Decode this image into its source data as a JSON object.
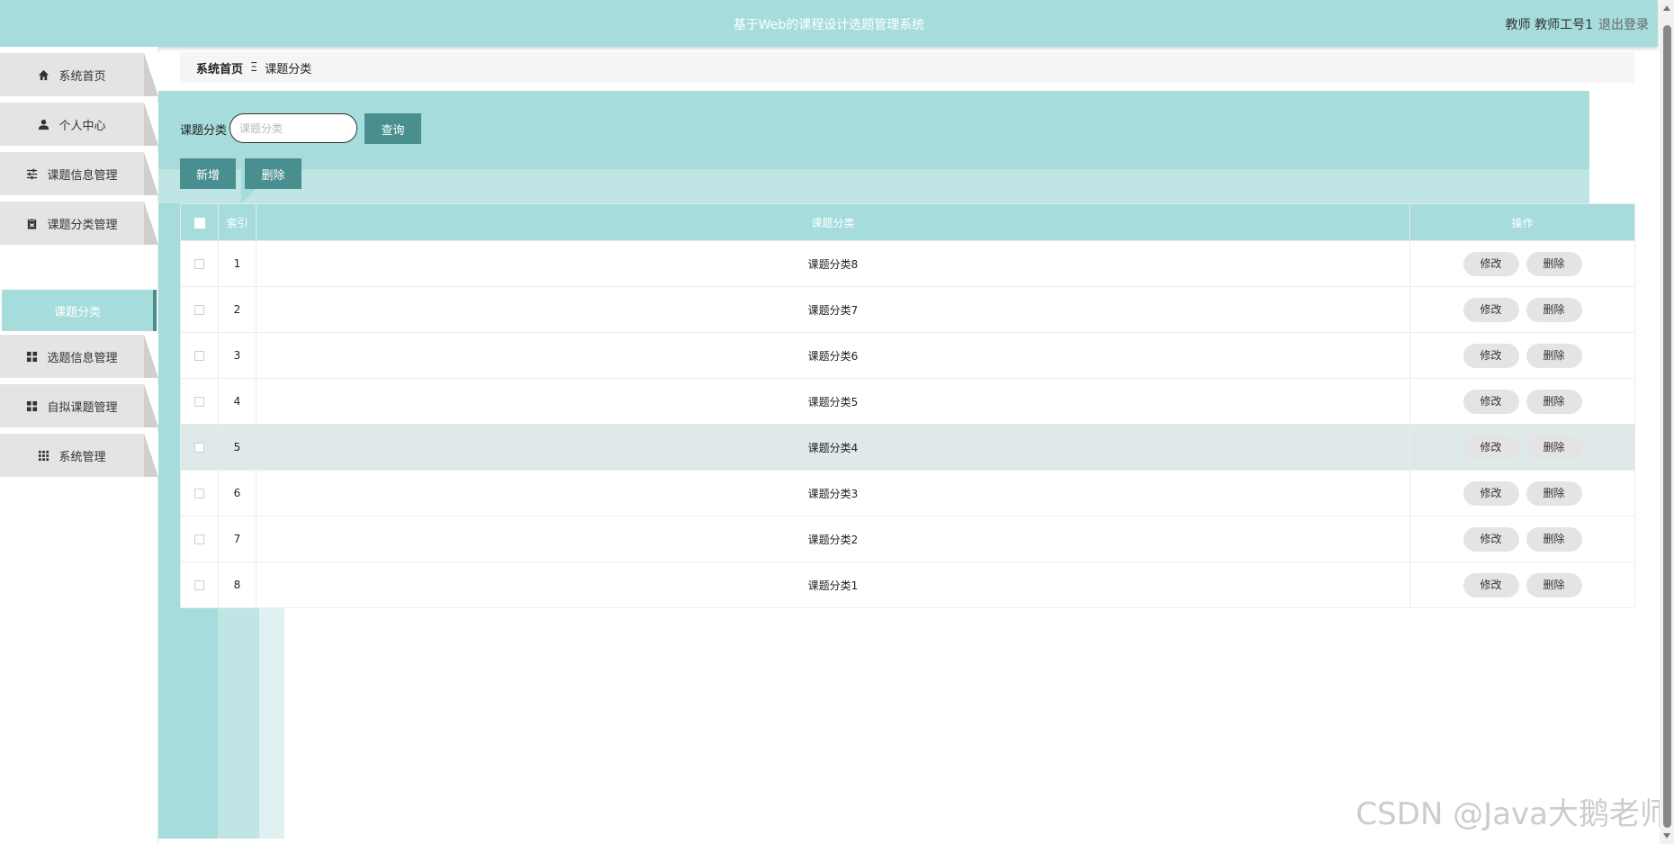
{
  "header": {
    "title": "基于Web的课程设计选题管理系统",
    "user": "教师 教师工号1",
    "logout": "退出登录"
  },
  "sidebar": {
    "items": [
      {
        "label": "系统首页",
        "icon": "home-icon"
      },
      {
        "label": "个人中心",
        "icon": "user-icon"
      },
      {
        "label": "课题信息管理",
        "icon": "sliders-icon"
      },
      {
        "label": "课题分类管理",
        "icon": "clipboard-icon"
      },
      {
        "label": "选题信息管理",
        "icon": "grid-icon"
      },
      {
        "label": "自拟课题管理",
        "icon": "grid-icon"
      },
      {
        "label": "系统管理",
        "icon": "apps-icon"
      }
    ],
    "active_sub": "课题分类"
  },
  "breadcrumb": {
    "home": "系统首页",
    "separator": "Ξ",
    "current": "课题分类"
  },
  "search": {
    "label": "课题分类",
    "placeholder": "课题分类",
    "button": "查询"
  },
  "actions": {
    "add": "新增",
    "delete": "删除"
  },
  "table": {
    "headers": {
      "index": "索引",
      "category": "课题分类",
      "ops": "操作"
    },
    "rows": [
      {
        "index": "1",
        "category": "课题分类8"
      },
      {
        "index": "2",
        "category": "课题分类7"
      },
      {
        "index": "3",
        "category": "课题分类6"
      },
      {
        "index": "4",
        "category": "课题分类5"
      },
      {
        "index": "5",
        "category": "课题分类4"
      },
      {
        "index": "6",
        "category": "课题分类3"
      },
      {
        "index": "7",
        "category": "课题分类2"
      },
      {
        "index": "8",
        "category": "课题分类1"
      }
    ],
    "highlighted_row": 4,
    "row_edit": "修改",
    "row_delete": "删除"
  },
  "watermark": "CSDN @Java大鹅老师",
  "colors": {
    "accent": "#a6dcdc",
    "accent_dark": "#4a8f90",
    "accent_light": "#bfe5e5",
    "row_highlight": "#dfe9e9"
  }
}
